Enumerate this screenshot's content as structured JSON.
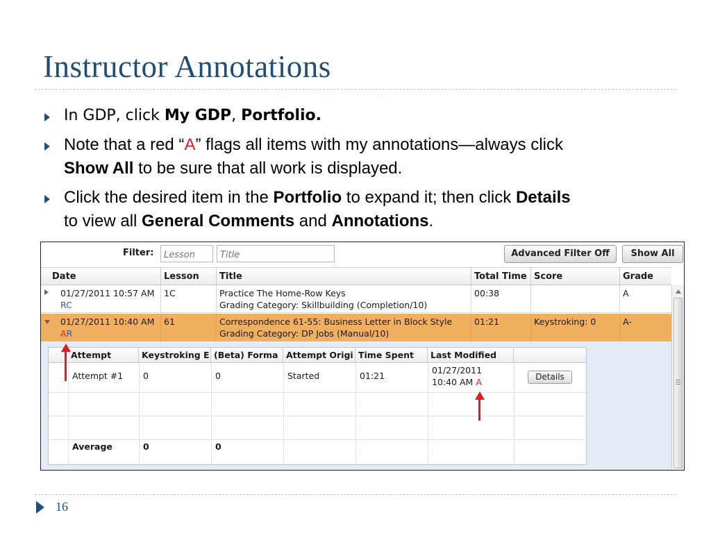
{
  "slide": {
    "title": "Instructor Annotations",
    "page_number": "16",
    "bullet1": {
      "prefix": "In GDP, click ",
      "bold1": "My GDP",
      "sep": ", ",
      "bold2": "Portfolio."
    },
    "bullet2": {
      "text1": "Note that a red “",
      "red_letter": "A",
      "text2": "” flags all items with my annotations—always click",
      "bold": "Show All",
      "text3": " to be sure that all work is displayed."
    },
    "bullet3": {
      "text1": "Click the desired item in the ",
      "bold1": "Portfolio",
      "text2": " to expand it; then click ",
      "bold2": "Details",
      "text3": "to view all ",
      "bold3": "General Comments",
      "text4": " and ",
      "bold4": "Annotations",
      "text5": "."
    }
  },
  "screenshot": {
    "filter_label": "Filter:",
    "lesson_placeholder": "Lesson",
    "title_placeholder": "Title",
    "advanced_filter_button": "Advanced Filter Off",
    "show_all_button": "Show All",
    "columns": [
      "Date",
      "Lesson",
      "Title",
      "Total Time",
      "Score",
      "Grade"
    ],
    "rows": [
      {
        "date": "01/27/2011 10:57 AM",
        "flags": "RC",
        "lesson": "1C",
        "title": "Practice The Home-Row Keys",
        "category": "Grading Category: Skillbuilding (Completion/10)",
        "total_time": "00:38",
        "score": "",
        "grade": "A"
      },
      {
        "date": "01/27/2011 10:40 AM",
        "flag_a": "A",
        "flag_r": "R",
        "lesson": "61",
        "title": "Correspondence 61-55: Business Letter in Block Style",
        "category": "Grading Category: DP Jobs (Manual/10)",
        "total_time": "01:21",
        "score": "Keystroking: 0",
        "grade": "A-"
      }
    ],
    "sub_columns": [
      "Attempt",
      "Keystroking E",
      "(Beta) Forma",
      "Attempt Origi",
      "Time Spent",
      "Last Modified"
    ],
    "attempt": {
      "name": "Attempt #1",
      "keystroking": "0",
      "beta_format": "0",
      "origin": "Started",
      "time_spent": "01:21",
      "modified_date": "01/27/2011",
      "modified_time": "10:40 AM",
      "flag": "A",
      "details_button": "Details"
    },
    "average": {
      "label": "Average",
      "keystroking": "0",
      "beta_format": "0"
    }
  },
  "colors": {
    "title_blue": "#1f4e79",
    "annotation_red": "#e02020",
    "selected_row": "#f0b060",
    "link_blue": "#2a57c7"
  }
}
